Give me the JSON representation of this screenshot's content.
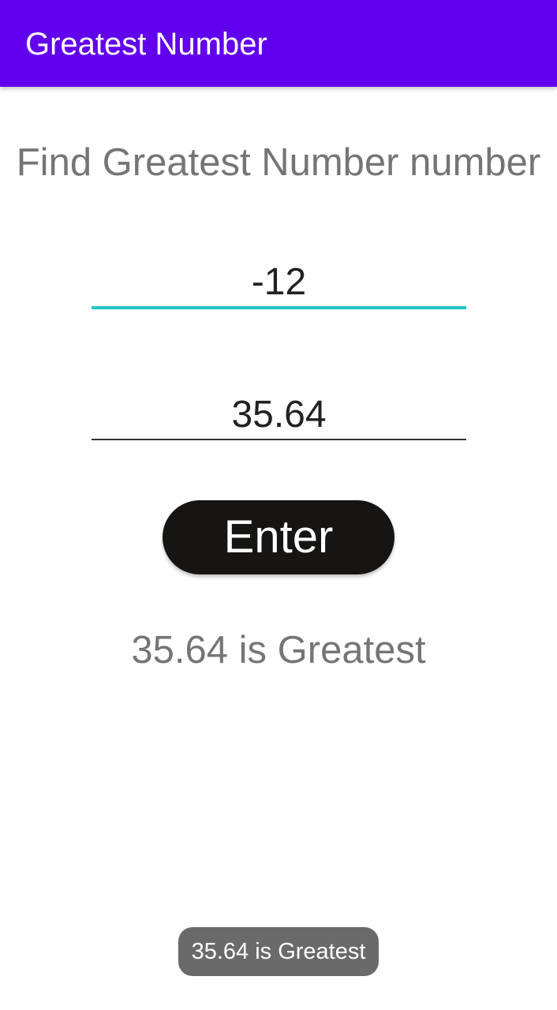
{
  "app_bar": {
    "title": "Greatest Number",
    "color": "#6200ee"
  },
  "main": {
    "heading": "Find Greatest Number number",
    "first_input": {
      "value": "-12",
      "focused": true,
      "accent_color": "#26c6c6"
    },
    "second_input": {
      "value": "35.64"
    },
    "enter_button": {
      "label": "Enter",
      "color": "#161514"
    },
    "result_text": "35.64 is Greatest"
  },
  "toast": {
    "message": "35.64 is Greatest"
  }
}
